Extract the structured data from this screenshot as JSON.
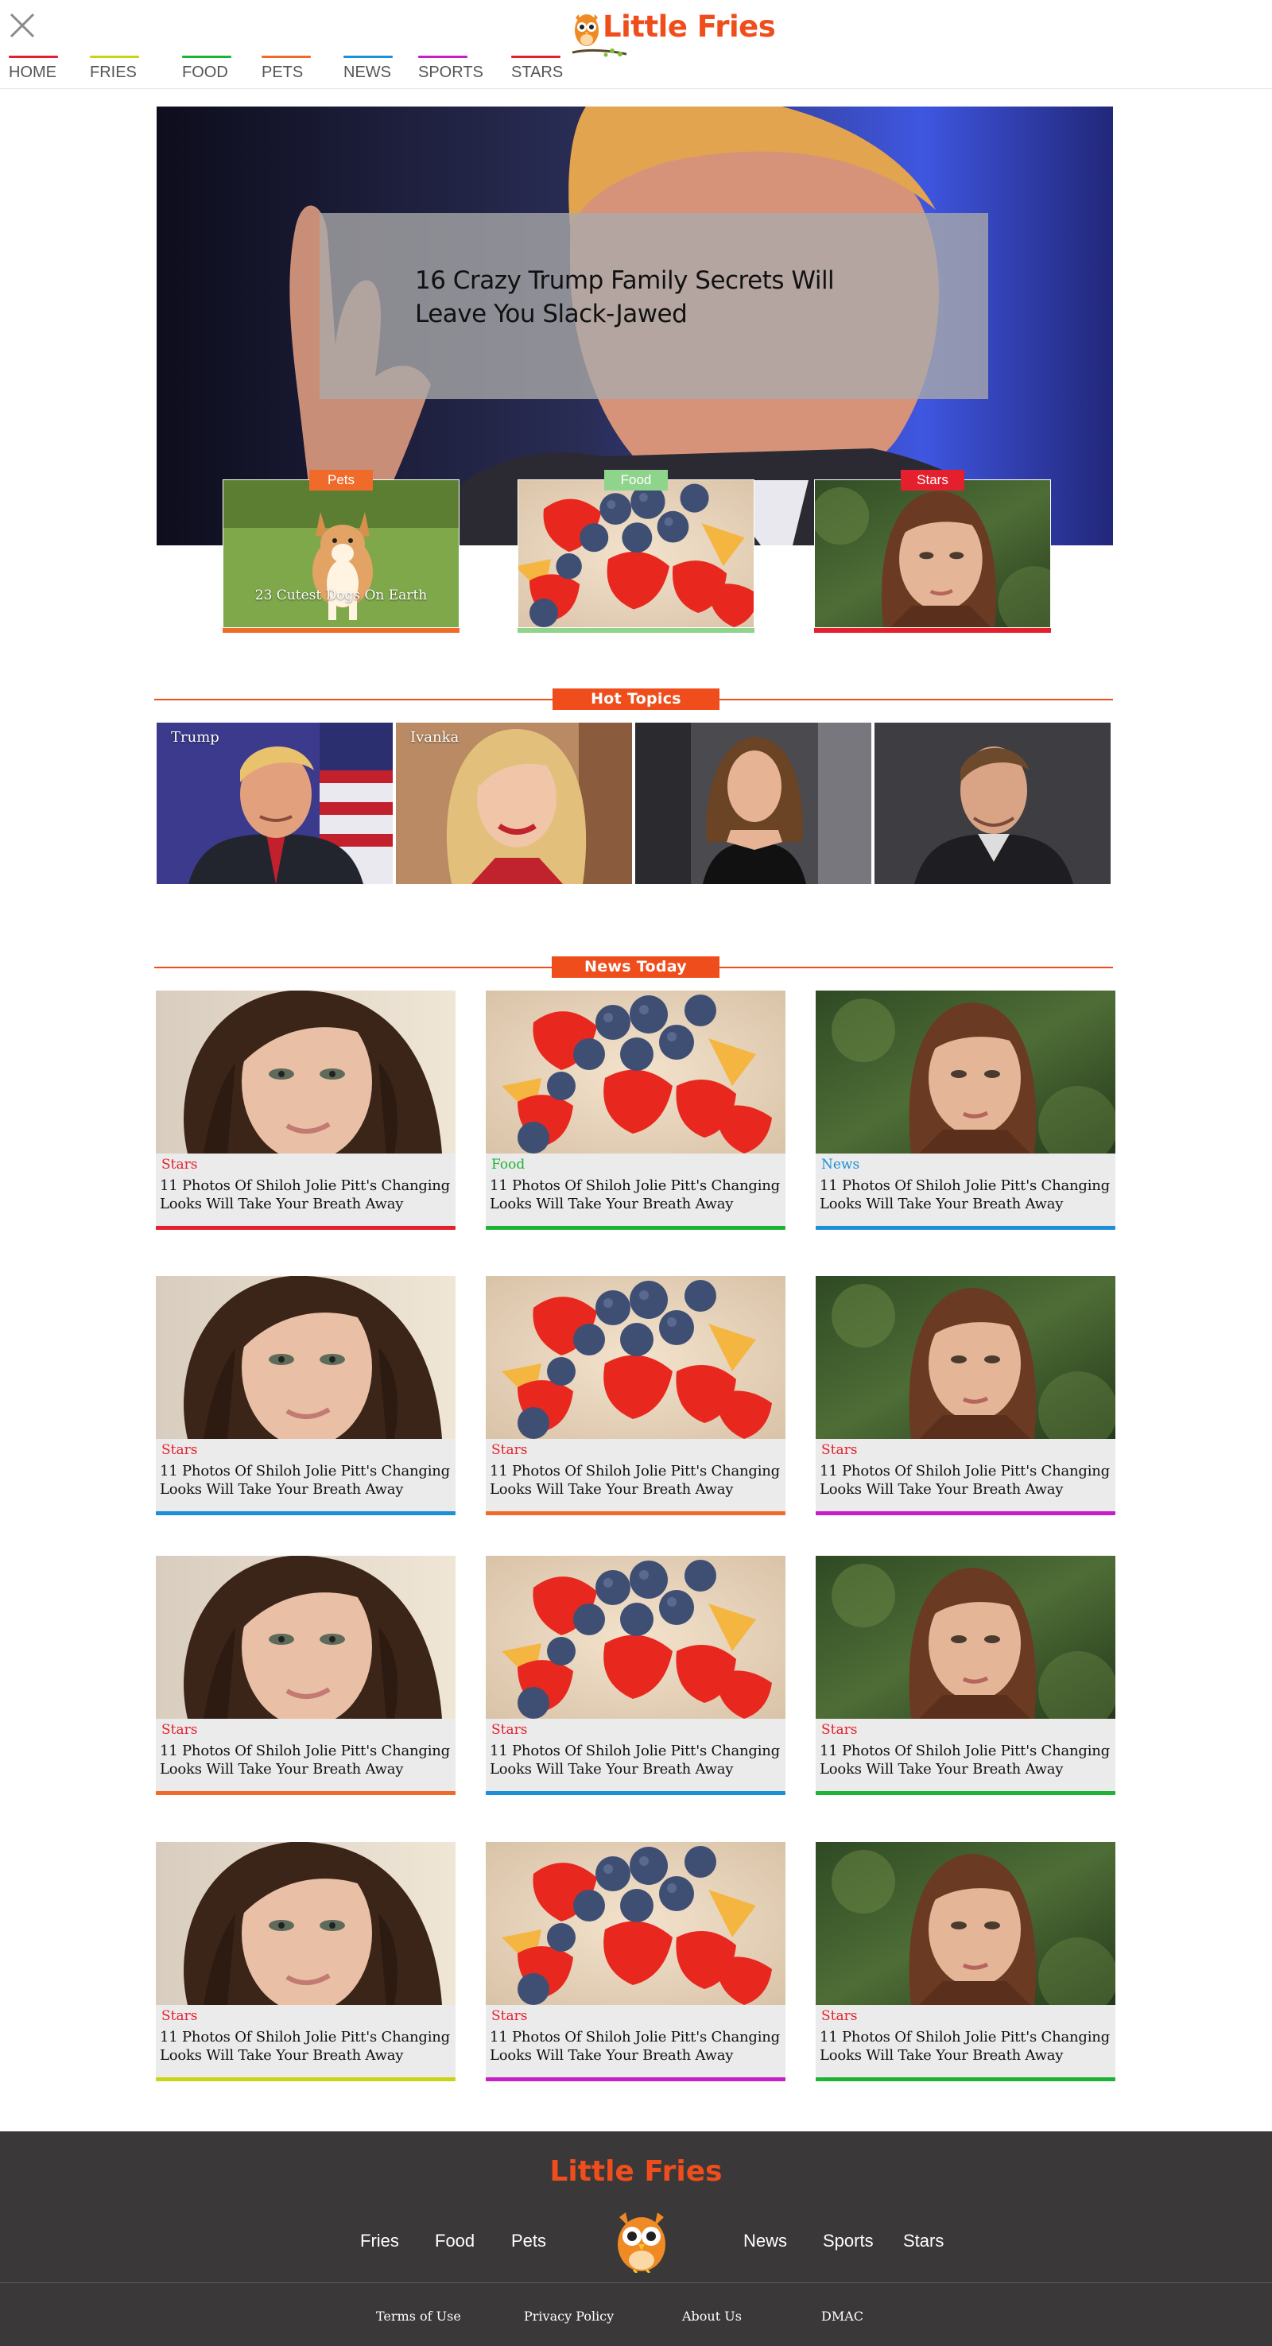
{
  "header": {
    "brand": "Little Fries",
    "nav": [
      {
        "label": "HOME",
        "color": "#e4202e"
      },
      {
        "label": "FRIES",
        "color": "#c9d417"
      },
      {
        "label": "FOOD",
        "color": "#1fb336"
      },
      {
        "label": "PETS",
        "color": "#f06b2a"
      },
      {
        "label": "NEWS",
        "color": "#1d8fd6"
      },
      {
        "label": "SPORTS",
        "color": "#c81ec8"
      },
      {
        "label": "STARS",
        "color": "#e4202e"
      }
    ]
  },
  "hero": {
    "title": "16 Crazy Trump Family Secrets Will Leave You Slack-Jawed"
  },
  "featured": [
    {
      "tag": "Pets",
      "color": "#f06b2a",
      "label": "23 Cutest Dogs On Earth",
      "image": "corgi-photo"
    },
    {
      "tag": "Food",
      "color": "#8fd48c",
      "label": "",
      "image": "berries-photo"
    },
    {
      "tag": "Stars",
      "color": "#e4202e",
      "label": "",
      "image": "woman-portrait-photo"
    }
  ],
  "hot_topics": {
    "title": "Hot Topics",
    "items": [
      {
        "label": "Trump",
        "image": "trump-photo"
      },
      {
        "label": "Ivanka",
        "image": "ivanka-photo"
      },
      {
        "label": "",
        "image": "actress-photo"
      },
      {
        "label": "",
        "image": "actor-photo"
      }
    ]
  },
  "news_today": {
    "title": "News Today",
    "cards": [
      {
        "category": "Stars",
        "cat_color": "#e4202e",
        "bar_color": "#e4202e",
        "image": "face",
        "title": "11 Photos Of Shiloh Jolie Pitt's Changing Looks Will Take Your Breath Away"
      },
      {
        "category": "Food",
        "cat_color": "#1fb336",
        "bar_color": "#1fb336",
        "image": "berries",
        "title": "11 Photos Of Shiloh Jolie Pitt's Changing Looks Will Take Your Breath Away"
      },
      {
        "category": "News",
        "cat_color": "#1d8fd6",
        "bar_color": "#1d8fd6",
        "image": "portrait",
        "title": "11 Photos Of Shiloh Jolie Pitt's Changing Looks Will Take Your Breath Away"
      },
      {
        "category": "Stars",
        "cat_color": "#e4202e",
        "bar_color": "#1d8fd6",
        "image": "face",
        "title": "11 Photos Of Shiloh Jolie Pitt's Changing Looks Will Take Your Breath Away"
      },
      {
        "category": "Stars",
        "cat_color": "#e4202e",
        "bar_color": "#f06b2a",
        "image": "berries",
        "title": "11 Photos Of Shiloh Jolie Pitt's Changing Looks Will Take Your Breath Away"
      },
      {
        "category": "Stars",
        "cat_color": "#e4202e",
        "bar_color": "#c81ec8",
        "image": "portrait",
        "title": "11 Photos Of Shiloh Jolie Pitt's Changing Looks Will Take Your Breath Away"
      },
      {
        "category": "Stars",
        "cat_color": "#e4202e",
        "bar_color": "#f06b2a",
        "image": "face",
        "title": "11 Photos Of Shiloh Jolie Pitt's Changing Looks Will Take Your Breath Away"
      },
      {
        "category": "Stars",
        "cat_color": "#e4202e",
        "bar_color": "#1d8fd6",
        "image": "berries",
        "title": "11 Photos Of Shiloh Jolie Pitt's Changing Looks Will Take Your Breath Away"
      },
      {
        "category": "Stars",
        "cat_color": "#e4202e",
        "bar_color": "#1fb336",
        "image": "portrait",
        "title": "11 Photos Of Shiloh Jolie Pitt's Changing Looks Will Take Your Breath Away"
      },
      {
        "category": "Stars",
        "cat_color": "#e4202e",
        "bar_color": "#c9d417",
        "image": "face",
        "title": "11 Photos Of Shiloh Jolie Pitt's Changing Looks Will Take Your Breath Away"
      },
      {
        "category": "Stars",
        "cat_color": "#e4202e",
        "bar_color": "#c81ec8",
        "image": "berries",
        "title": "11 Photos Of Shiloh Jolie Pitt's Changing Looks Will Take Your Breath Away"
      },
      {
        "category": "Stars",
        "cat_color": "#e4202e",
        "bar_color": "#1fb336",
        "image": "portrait",
        "title": "11 Photos Of Shiloh Jolie Pitt's Changing Looks Will Take Your Breath Away"
      }
    ]
  },
  "footer": {
    "brand": "Little Fries",
    "links": [
      "Fries",
      "Food",
      "Pets",
      "News",
      "Sports",
      "Stars"
    ],
    "legal": [
      "Terms of Use",
      "Privacy Policy",
      "About Us",
      "DMAC"
    ]
  },
  "colors": {
    "brand_orange": "#ef4e1c",
    "footer_bg": "#3a3838",
    "card_bg": "#ebebeb"
  }
}
